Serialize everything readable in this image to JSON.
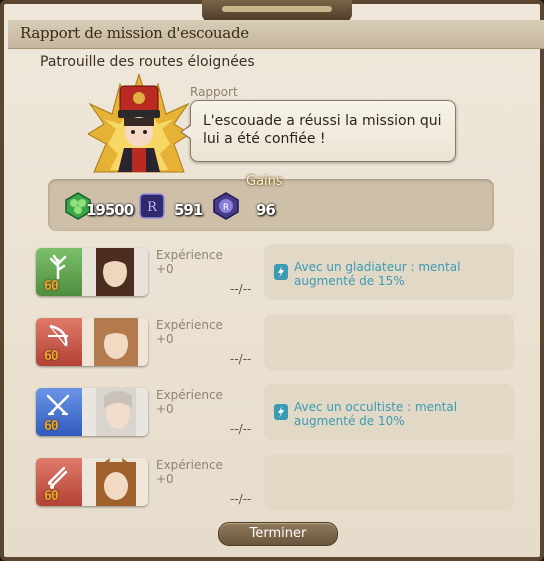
{
  "window": {
    "title": "Rapport de mission d'escouade"
  },
  "mission": {
    "name": "Patrouille des routes éloignées"
  },
  "report": {
    "label": "Rapport",
    "message": "L'escouade a réussi la mission qui lui a été confiée !"
  },
  "gains": {
    "label": "Gains",
    "items": [
      {
        "icon": "gil-icon",
        "value": "19500"
      },
      {
        "icon": "company-seal-icon",
        "value": "591"
      },
      {
        "icon": "tomestone-icon",
        "value": "96"
      }
    ]
  },
  "members": [
    {
      "job_icon": "conjurer-icon",
      "level": "60",
      "exp_label": "Expérience",
      "exp_value": "+0",
      "progress": "--/--",
      "bonus": "Avec un gladiateur : mental augmenté de 15%",
      "job_color": "#5fa34a"
    },
    {
      "job_icon": "archer-icon",
      "level": "60",
      "exp_label": "Expérience",
      "exp_value": "+0",
      "progress": "--/--",
      "bonus": "",
      "job_color": "#c9473a"
    },
    {
      "job_icon": "gladiator-icon",
      "level": "60",
      "exp_label": "Expérience",
      "exp_value": "+0",
      "progress": "--/--",
      "bonus": "Avec un occultiste : mental augmenté de 10%",
      "job_color": "#3f6fc9"
    },
    {
      "job_icon": "rogue-icon",
      "level": "60",
      "exp_label": "Expérience",
      "exp_value": "+0",
      "progress": "--/--",
      "bonus": "",
      "job_color": "#c9473a"
    }
  ],
  "actions": {
    "finish_label": "Terminer"
  }
}
